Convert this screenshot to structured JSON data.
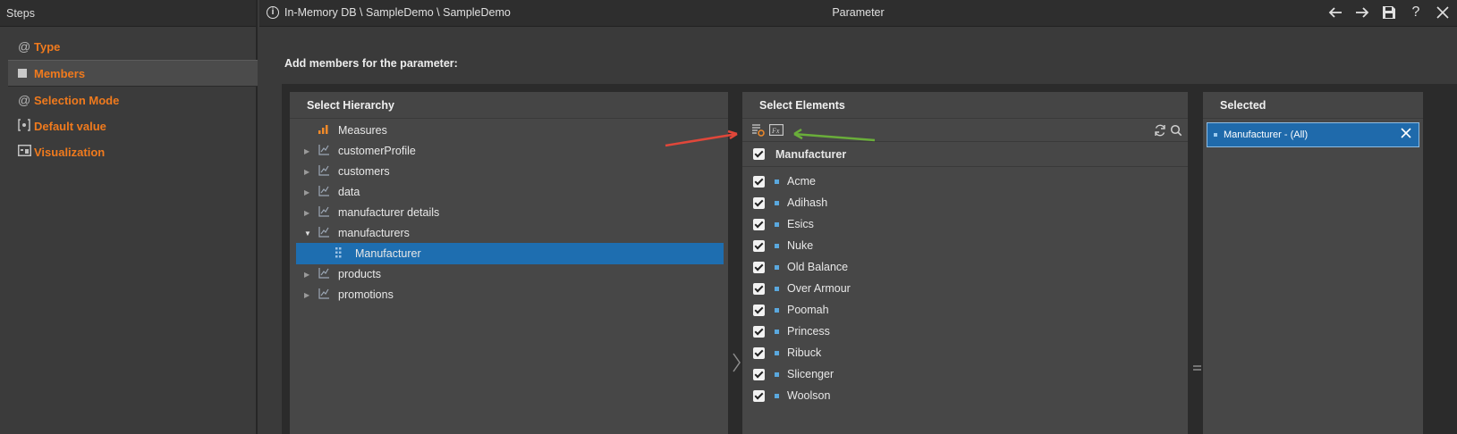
{
  "steps": {
    "header": "Steps",
    "items": [
      {
        "label": "Type",
        "icon": "@"
      },
      {
        "label": "Members",
        "icon": "square"
      },
      {
        "label": "Selection Mode",
        "icon": "@"
      },
      {
        "label": "Default value",
        "icon": "[•]"
      },
      {
        "label": "Visualization",
        "icon": "window"
      }
    ]
  },
  "topbar": {
    "breadcrumb": "In-Memory DB \\ SampleDemo \\ SampleDemo",
    "title": "Parameter",
    "tools": [
      "arrow-left",
      "arrow-right",
      "save",
      "help",
      "close"
    ],
    "help": "?"
  },
  "main": {
    "prompt": "Add members for the parameter:"
  },
  "hierarchy": {
    "title": "Select Hierarchy",
    "items": [
      {
        "label": "Measures"
      },
      {
        "label": "customerProfile"
      },
      {
        "label": "customers"
      },
      {
        "label": "data"
      },
      {
        "label": "manufacturer details"
      },
      {
        "label": "manufacturers"
      },
      {
        "label": "Manufacturer"
      },
      {
        "label": "products"
      },
      {
        "label": "promotions"
      }
    ]
  },
  "elements": {
    "title": "Select Elements",
    "header": "Manufacturer",
    "items": [
      "Acme",
      "Adihash",
      "Esics",
      "Nuke",
      "Old Balance",
      "Over Armour",
      "Poomah",
      "Princess",
      "Ribuck",
      "Slicenger",
      "Woolson"
    ]
  },
  "selected": {
    "title": "Selected",
    "items": [
      {
        "label": "Manufacturer - (All)"
      }
    ]
  },
  "colors": {
    "accent": "#f07a1d",
    "selection": "#1e6eb0",
    "arrow_red": "#e0473a",
    "arrow_green": "#6aae3a"
  }
}
